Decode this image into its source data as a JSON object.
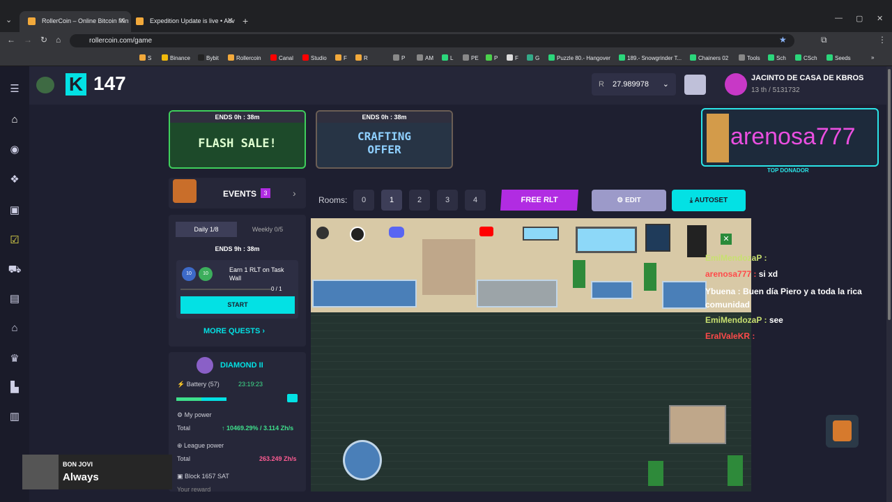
{
  "browser": {
    "tabs": [
      {
        "label": "RollerCoin – Online Bitcoin Min",
        "active": true
      },
      {
        "label": "Expedition Update is live • Adv",
        "active": false
      }
    ],
    "new_tab": "+",
    "url": "rollercoin.com/game",
    "bookmarks": [
      "S",
      "Binance",
      "Bybit",
      "Rollercoin",
      "Canal",
      "Studio",
      "F",
      "R",
      "P",
      "AM",
      "L",
      "PE",
      "P",
      "F",
      "G",
      "Puzzle 80.- Hangover",
      "189.- Snowgrinder T...",
      "Chainers 02",
      "Tools",
      "Sch",
      "CSch",
      "Seeds"
    ]
  },
  "header": {
    "k_logo": "K",
    "k_count": "147",
    "balance": "27.989978",
    "balance_currency_icon": "R",
    "username": "JACINTO DE CASA DE KBROS",
    "rank": "13 th / 5131732"
  },
  "banners": [
    {
      "ends": "ENDS  0h : 38m",
      "title": "FLASH SALE!"
    },
    {
      "ends": "ENDS  0h : 38m",
      "title": "CRAFTING OFFER"
    }
  ],
  "donor": {
    "name": "arenosa777",
    "label": "TOP DONADOR"
  },
  "events": {
    "label": "EVENTS",
    "count": "3"
  },
  "quests": {
    "daily": "Daily  1/8",
    "weekly": "Weekly  0/5",
    "ends": "ENDS  9h : 38m",
    "task": "Earn 1 RLT on Task Wall",
    "xp": "10",
    "reward": "10",
    "progress": "0 / 1",
    "start": "START",
    "more": "MORE QUESTS"
  },
  "league": {
    "name": "DIAMOND II"
  },
  "stats": {
    "battery_label": "Battery (57)",
    "battery_time": "23:19:23",
    "my_power": "My power",
    "total_label": "Total",
    "my_power_value": "↑ 10469.29% / 3.114 Zh/s",
    "league_power": "League power",
    "league_total": "263.249 Zh/s",
    "block": "Block 1657 SAT",
    "your_reward": "Your reward"
  },
  "rooms": {
    "label": "Rooms:",
    "items": [
      "0",
      "1",
      "2",
      "3",
      "4"
    ],
    "active": "1",
    "free_rlt": "FREE RLT",
    "edit": "EDIT",
    "autoset": "AUTOSET"
  },
  "chat": [
    {
      "user": "EmiMendozaP :",
      "text": ""
    },
    {
      "user": "arenosa777 :",
      "text": "si xd"
    },
    {
      "user": "Ybuena :",
      "text": "Buen día Piero y a toda la rica comunidad"
    },
    {
      "user": "EmiMendozaP :",
      "text": "see"
    },
    {
      "user": "EralValeKR :",
      "text": ""
    }
  ],
  "now_playing": {
    "artist": "BON JOVI",
    "title": "Always"
  },
  "colors": {
    "accent": "#03e1e4",
    "purple": "#b12ce2",
    "bg": "#1e1f30"
  }
}
